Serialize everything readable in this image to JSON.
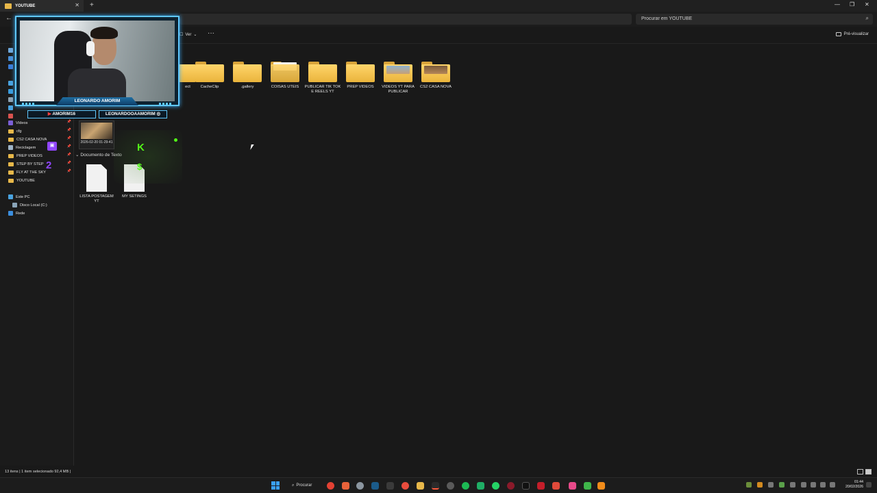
{
  "window": {
    "tab_title": "YOUTUBE",
    "search_placeholder": "Procurar em YOUTUBE"
  },
  "commandbar": {
    "view_label": "Ver",
    "more_label": "···",
    "preview_label": "Pré-visualizar"
  },
  "sidebar": {
    "items": [
      {
        "label": "Vídeos",
        "icon": "videos-icon",
        "pinned": true
      },
      {
        "label": "cfg",
        "icon": "folder-icon",
        "pinned": true
      },
      {
        "label": "CS2 CASA NOVA",
        "icon": "folder-icon",
        "pinned": true
      },
      {
        "label": "Reciclagem",
        "icon": "recycle-bin-icon",
        "pinned": true
      },
      {
        "label": "PREP VIDEOS",
        "icon": "folder-icon",
        "pinned": true
      },
      {
        "label": "STEP BY STEP",
        "icon": "folder-icon",
        "pinned": true
      },
      {
        "label": "FLY AT THE SKY",
        "icon": "folder-icon",
        "pinned": true
      },
      {
        "label": "YOUTUBE",
        "icon": "folder-icon",
        "pinned": false
      }
    ],
    "system": [
      {
        "label": "Este PC",
        "icon": "pc-icon"
      },
      {
        "label": "Disco Local (C:)",
        "icon": "drive-icon"
      },
      {
        "label": "Rede",
        "icon": "network-icon"
      }
    ]
  },
  "folders": [
    {
      "label": "ect"
    },
    {
      "label": "CacheClip"
    },
    {
      "label": ".gallery"
    },
    {
      "label": "COISAS UTEIS"
    },
    {
      "label": "PUBLICAR TIK TOK E REELS YT"
    },
    {
      "label": "PREP VIDEOS"
    },
    {
      "label": "VIDEOS YT PARA PUBLICAR"
    },
    {
      "label": "CS2 CASA NOVA"
    }
  ],
  "video_thumb": {
    "label": "2026-02-20 01-29-41"
  },
  "group_text": {
    "header": "Documento de Texto"
  },
  "documents": [
    {
      "label": "LISTA POSTAGEM YT"
    },
    {
      "label": "MY SETINGS"
    }
  ],
  "overlay": {
    "name": "LEONARDO AMORIM",
    "handle_youtube": "AMORIM16",
    "handle_instagram": "LEONARDOOAAMORIM",
    "colors": {
      "frame": "#5fc8ff",
      "kick": "#53fc18",
      "twitch": "#9146ff"
    }
  },
  "statusbar": {
    "items_count": "13 itens",
    "selection": "1 item selecionado 92,4 MB"
  },
  "taskbar": {
    "search_label": "Procurar",
    "time": "01:44",
    "date": "20/02/2026"
  }
}
